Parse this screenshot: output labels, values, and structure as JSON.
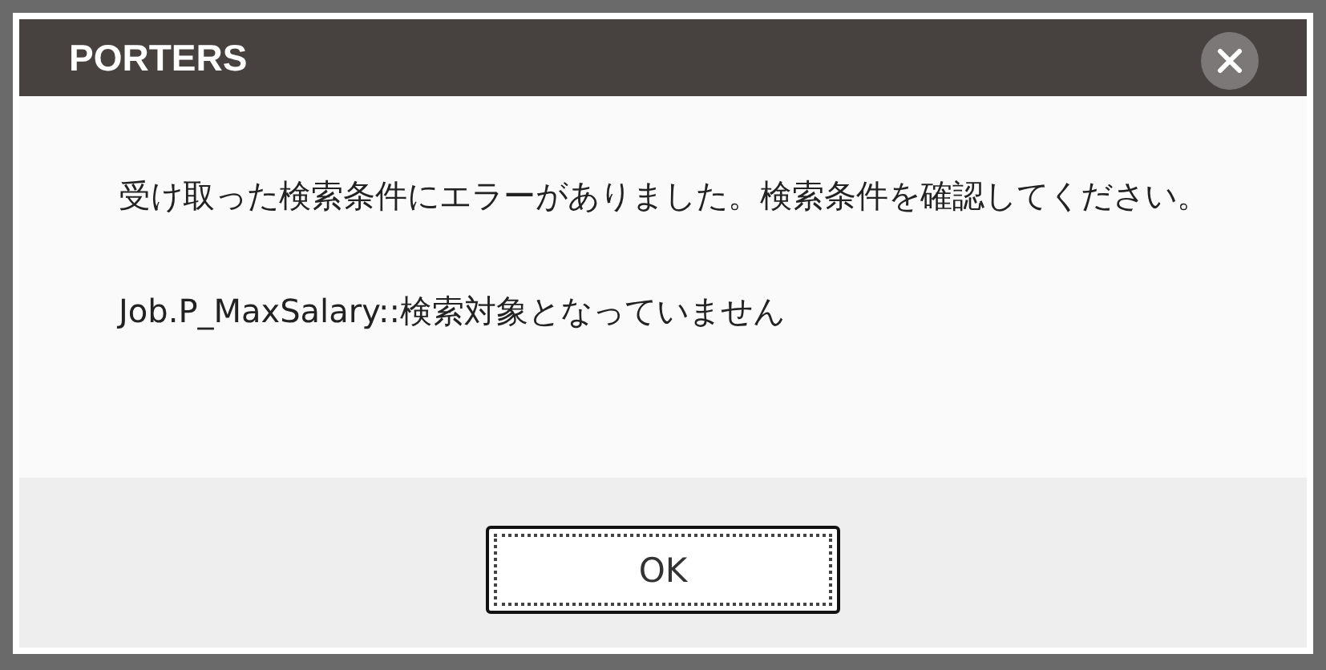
{
  "dialog": {
    "title": "PORTERS",
    "message": "受け取った検索条件にエラーがありました。検索条件を確認してください。",
    "detail": "Job.P_MaxSalary::検索対象となっていません",
    "buttons": [
      "OK"
    ]
  }
}
